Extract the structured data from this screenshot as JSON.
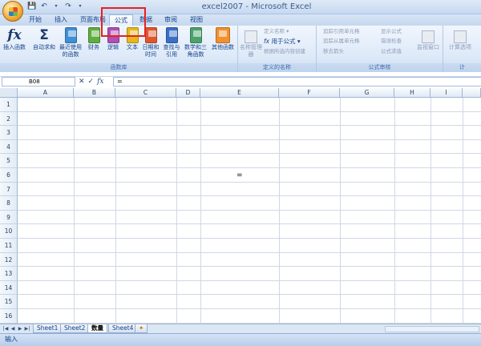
{
  "window": {
    "title": "excel2007 - Microsoft Excel"
  },
  "qat": {
    "save_icon": "save-icon",
    "undo_icon": "undo-icon",
    "redo_icon": "redo-icon"
  },
  "tabs": [
    {
      "label": "开始"
    },
    {
      "label": "插入"
    },
    {
      "label": "页面布局"
    },
    {
      "label": "公式"
    },
    {
      "label": "数据"
    },
    {
      "label": "审阅"
    },
    {
      "label": "视图"
    }
  ],
  "ribbon": {
    "function_library": {
      "label": "函数库",
      "insert_function": "插入函数",
      "autosum": "自动求和",
      "recent": "最近使用的函数",
      "financial": "财务",
      "logical": "逻辑",
      "text": "文本",
      "datetime": "日期和时间",
      "lookup": "查找与引用",
      "math": "数学和三角函数",
      "more": "其他函数"
    },
    "defined_names": {
      "label": "定义的名称",
      "name_manager": "名称管理器",
      "define_name": "定义名称",
      "use_in_formula": "用于公式",
      "create_from_selection": "根据所选内容创建"
    },
    "formula_auditing": {
      "label": "公式审核",
      "trace_precedents": "追踪引用单元格",
      "trace_dependents": "追踪从属单元格",
      "remove_arrows": "移去箭头",
      "show_formulas": "显示公式",
      "error_checking": "错误检查",
      "evaluate_formula": "公式求值",
      "watch_window": "监视窗口"
    },
    "calculation": {
      "label": "计",
      "calc_options": "计算选项"
    }
  },
  "formula_bar": {
    "name_box": "B08",
    "fx": "fx",
    "content": "="
  },
  "grid": {
    "columns": [
      "A",
      "B",
      "C",
      "D",
      "E",
      "F",
      "G",
      "H",
      "I"
    ],
    "rows": [
      "1",
      "2",
      "3",
      "4",
      "5",
      "6",
      "7",
      "8",
      "9",
      "10",
      "11",
      "12",
      "13",
      "14",
      "15",
      "16"
    ],
    "cell_text": "="
  },
  "sheets": [
    {
      "label": "Sheet1"
    },
    {
      "label": "Sheet2"
    },
    {
      "label": "数量"
    },
    {
      "label": "Sheet4"
    }
  ],
  "status": {
    "mode": "输入"
  },
  "colors": {
    "highlight_box": "#e8211f",
    "ribbon_bg": "#dde9f8"
  }
}
